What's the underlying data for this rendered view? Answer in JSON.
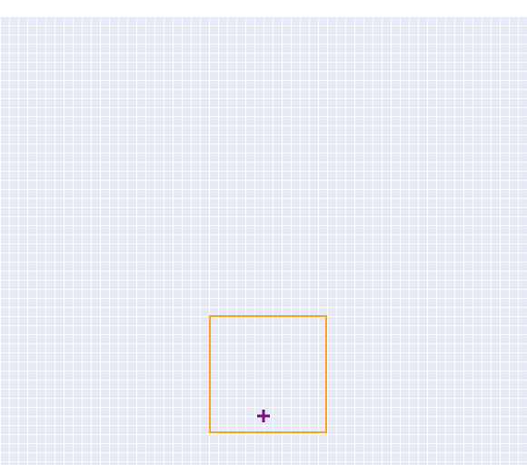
{
  "colors": {
    "canvas_background": "#e5eaf6",
    "grid_line": "#ffffff",
    "selection_border": "#f5a623",
    "crosshair": "#7a0f7a"
  },
  "icons": {
    "crosshair": "plus-crosshair-icon"
  }
}
